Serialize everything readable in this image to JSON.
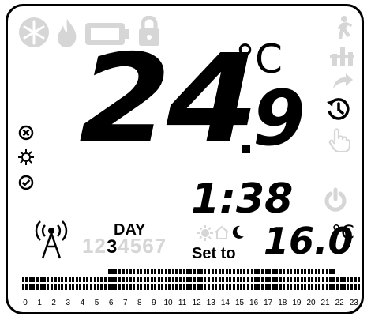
{
  "display": {
    "temperature_main": "24",
    "temperature_decimal": "9",
    "temperature_unit": "°C",
    "time": "1:38",
    "day_label": "DAY",
    "day_value": "3",
    "day_digits_faint": [
      "1",
      "2",
      "4",
      "5",
      "6",
      "7"
    ],
    "set_to_label": "Set to",
    "set_temperature": "16.0",
    "set_temperature_unit": "°C"
  },
  "schedule": {
    "hours": [
      "0",
      "1",
      "2",
      "3",
      "4",
      "5",
      "6",
      "7",
      "8",
      "9",
      "10",
      "11",
      "12",
      "13",
      "14",
      "15",
      "16",
      "17",
      "18",
      "19",
      "20",
      "21",
      "22",
      "23"
    ],
    "heating_hours": [
      6,
      7,
      8,
      9,
      10,
      11,
      12,
      13,
      14,
      15,
      16,
      17,
      18,
      19,
      20,
      21
    ],
    "top_row_active": true
  },
  "icons": {
    "top_left": [
      "snowflake-icon",
      "flame-icon",
      "battery-icon",
      "lock-icon"
    ],
    "top_right": [
      "person-away-icon",
      "thermostat-valve-icon",
      "redo-arrow-icon"
    ],
    "right": [
      "history-icon",
      "hand-pointer-icon",
      "power-icon"
    ],
    "left": [
      "cancel-icon",
      "settings-gear-icon",
      "confirm-check-icon"
    ],
    "signal": "antenna-signal-icon",
    "modes": [
      "sun-icon",
      "home-icon",
      "moon-icon"
    ]
  }
}
